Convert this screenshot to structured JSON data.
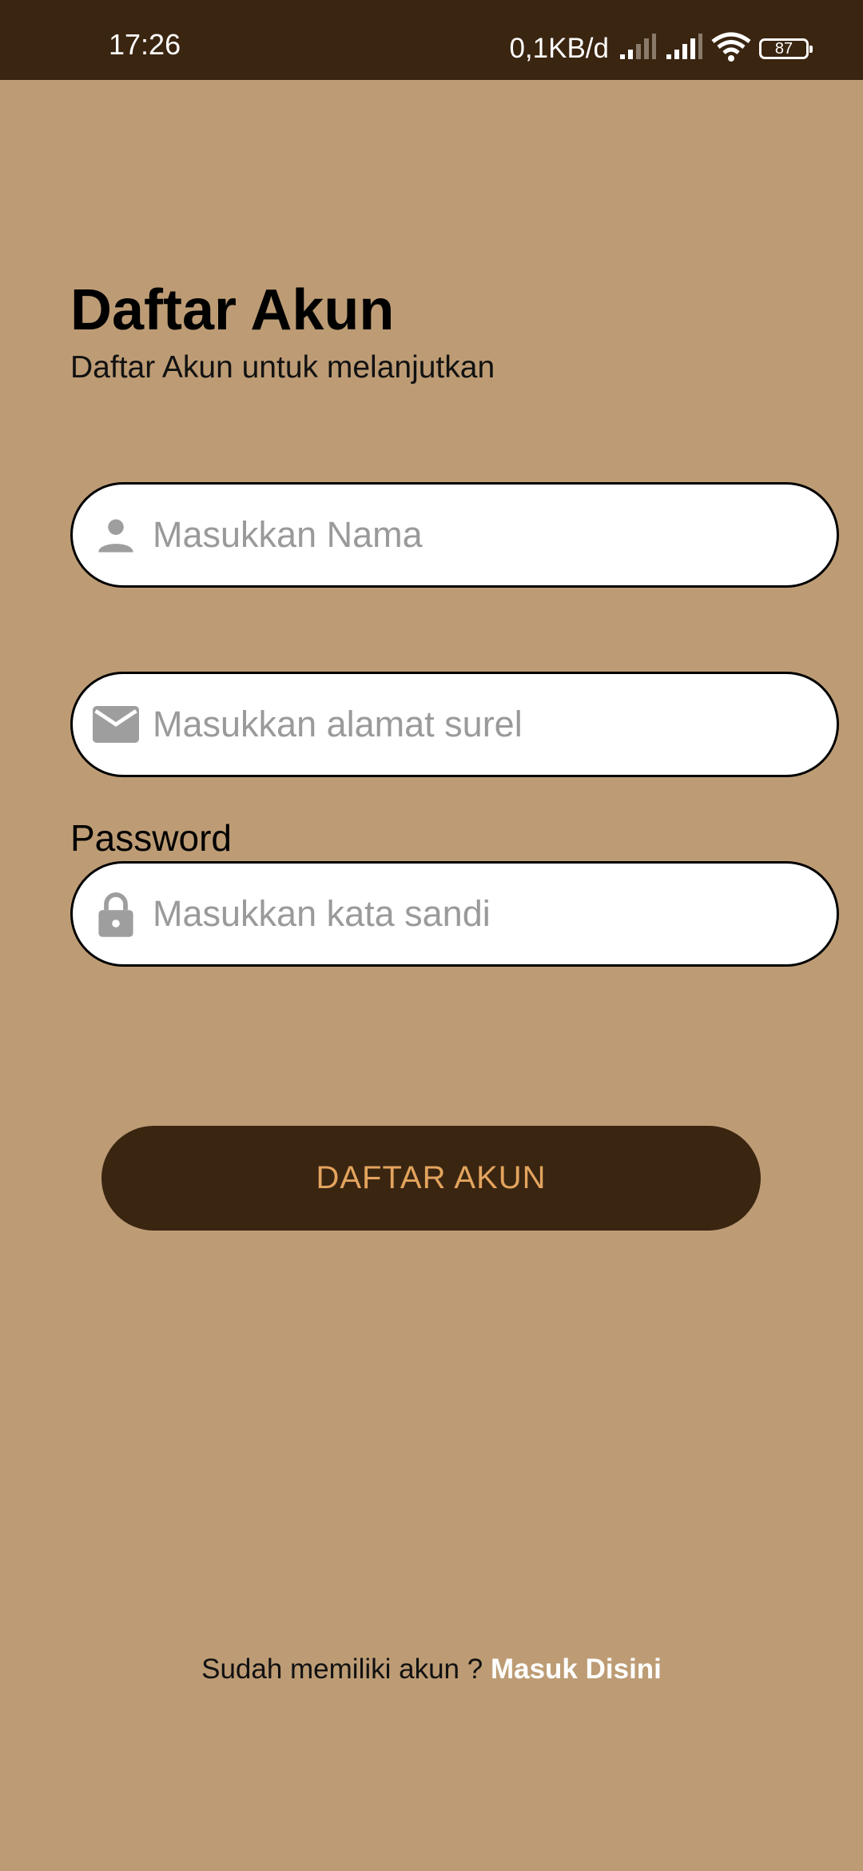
{
  "status_bar": {
    "time": "17:26",
    "net_speed": "0,1KB/d",
    "battery": "87",
    "icons": [
      "signal-weak-icon",
      "signal-icon",
      "wifi-icon",
      "battery-icon"
    ]
  },
  "page": {
    "title": "Daftar Akun",
    "subtitle": "Daftar Akun untuk melanjutkan"
  },
  "form": {
    "name_field": {
      "placeholder": "Masukkan Nama",
      "value": "",
      "icon": "person-icon"
    },
    "email_field": {
      "placeholder": "Masukkan alamat surel",
      "value": "",
      "icon": "mail-icon"
    },
    "password_label": "Password",
    "password_field": {
      "placeholder": "Masukkan kata sandi",
      "value": "",
      "icon": "lock-icon"
    },
    "submit_label": "DAFTAR AKUN"
  },
  "footer": {
    "prompt": "Sudah memiliki akun ?",
    "link_label": "Masuk Disini"
  },
  "colors": {
    "background": "#BD9C75",
    "dark_brown": "#3A2511",
    "button_text": "#E3A45E",
    "icon_gray": "#9E9E9E"
  }
}
